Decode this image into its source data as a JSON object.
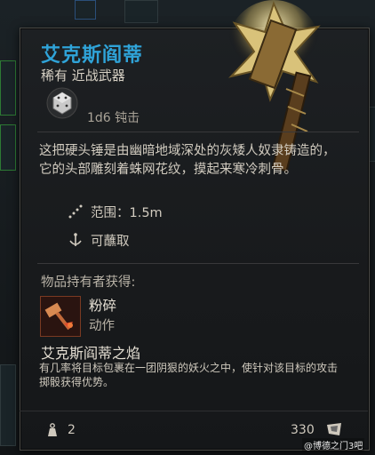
{
  "item": {
    "name": "艾克斯阎蒂",
    "rarity_type": "稀有 近战武器",
    "damage": "1d6 钝击",
    "description": "这把硬头锤是由幽暗地域深处的灰矮人奴隶铸造的，它的头部雕刻着蛛网花纹，摸起来寒冷刺骨。",
    "properties": [
      {
        "icon": "range-icon",
        "label": "范围：1.5m"
      },
      {
        "icon": "dip-icon",
        "label": "可蘸取"
      }
    ],
    "grants_header": "物品持有者获得:",
    "action": {
      "icon": "smash-icon",
      "name": "粉碎",
      "type": "动作"
    },
    "feature": {
      "title": "艾克斯阎蒂之焰",
      "description": "有几率将目标包裹在一团阴狠的妖火之中，使针对该目标的攻击掷骰获得优势。"
    },
    "weight": "2",
    "price": "330"
  },
  "watermark": "@博德之门3吧",
  "colors": {
    "title": "#2fa3d8",
    "action_border": "#7a3a22"
  }
}
